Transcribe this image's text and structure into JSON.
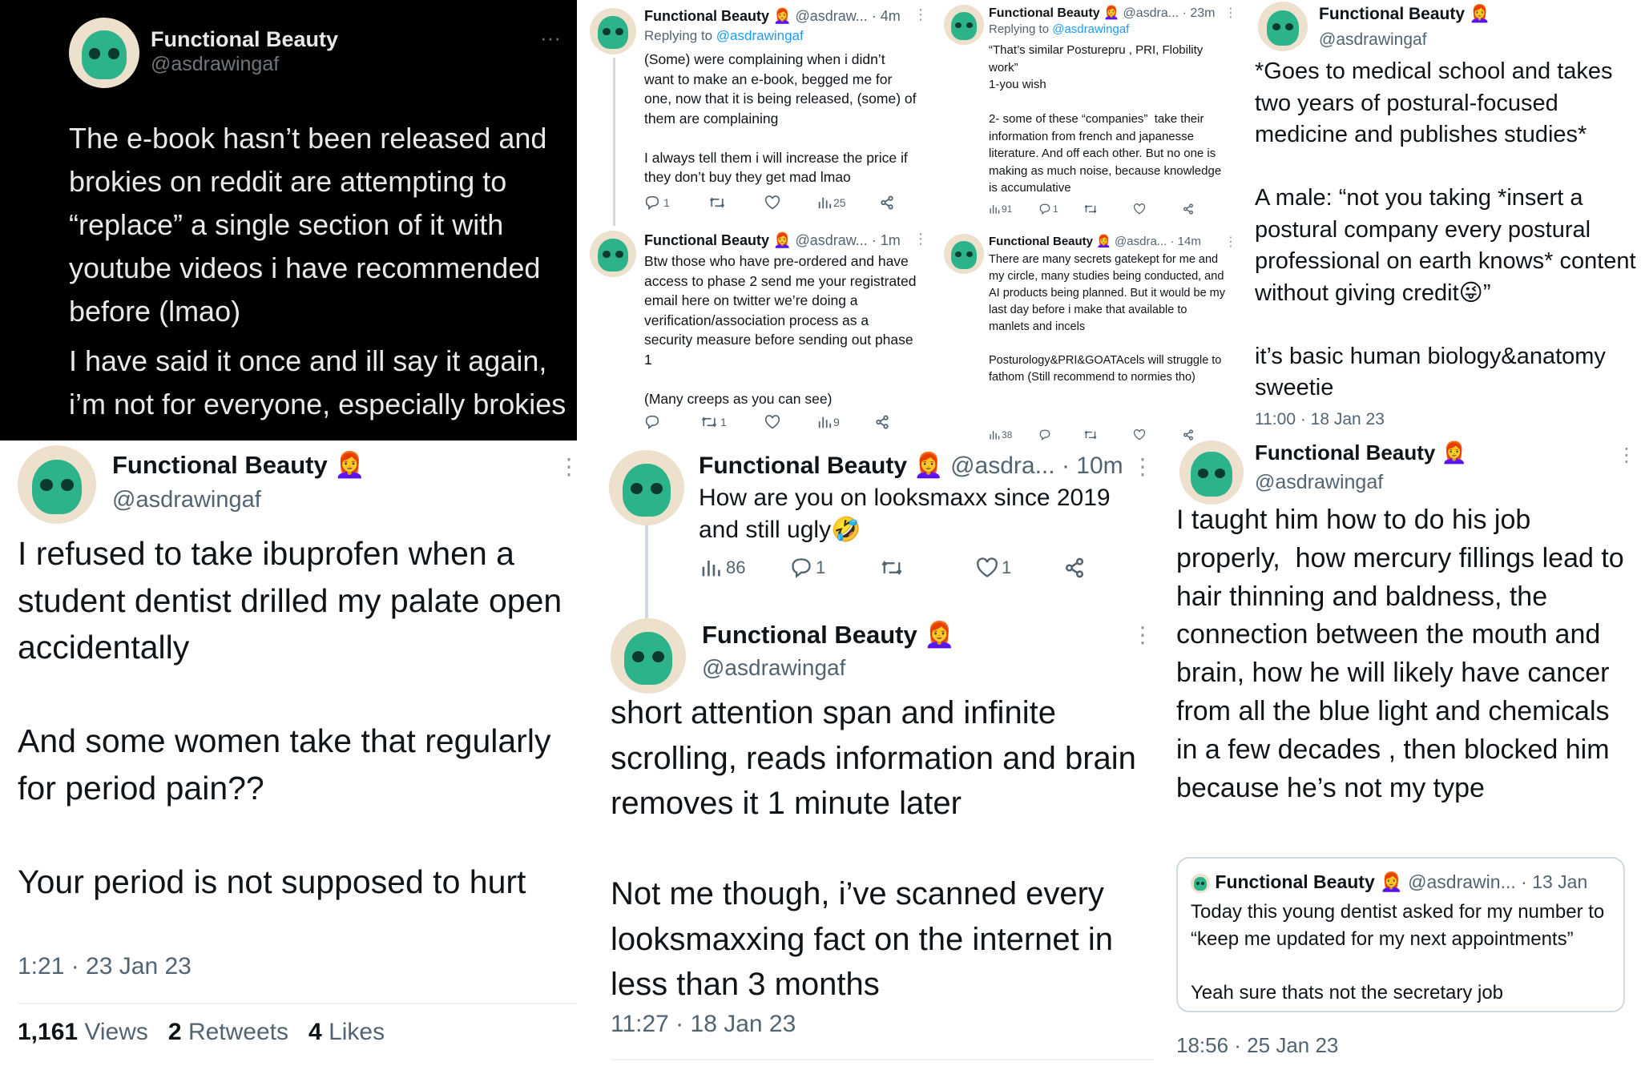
{
  "p1": {
    "name": "Functional Beauty",
    "handle": "@asdrawingaf",
    "text1": "The e-book hasn’t been released and brokies on reddit are attempting to “replace” a single section of it with youtube videos i have recommended before (lmao)",
    "text2": "I have said it once and ill say it again, i’m not for everyone, especially brokies",
    "more": "···"
  },
  "p2": {
    "t1": {
      "name": "Functional Beauty",
      "emoji": "👩‍🦰",
      "handle": "@asdraw...",
      "time": "· 4m",
      "replying_label": "Replying to",
      "replying_to": "@asdrawingaf",
      "text": "(Some) were complaining when i didn’t want to make an e-book, begged me for one, now that it is being released, (some) of them are complaining\n\nI always tell them i will increase the price if they don’t buy they get mad lmao",
      "replies": "1",
      "retweets": "",
      "likes": "",
      "views": "25"
    },
    "t2": {
      "name": "Functional Beauty",
      "emoji": "👩‍🦰",
      "handle": "@asdraw...",
      "time": "· 1m",
      "text": "Btw those who have pre-ordered and have access to phase 2 send me your registrated email here on twitter we’re doing a verification/association process as a security measure before sending out phase 1\n\n(Many creeps as you can see)",
      "replies": "",
      "retweets": "1",
      "likes": "",
      "views": "9"
    }
  },
  "p3": {
    "t1": {
      "name": "Functional Beauty",
      "emoji": "👩‍🦰",
      "handle": "@asdra...",
      "time": "· 23m",
      "replying_label": "Replying to",
      "replying_to": "@asdrawingaf",
      "text": "“That’s similar Posturepru , PRI, Flobility work”\n1-you wish\n\n2- some of these “companies”  take their information from french and japanesse literature. And off each other. But no one is making as much noise, because knowledge is accumulative",
      "views": "91",
      "replies": "1",
      "retweets": "",
      "likes": ""
    },
    "t2": {
      "name": "Functional Beauty",
      "emoji": "👩‍🦰",
      "handle": "@asdra...",
      "time": "· 14m",
      "text": "There are many secrets gatekept for me and my circle, many studies being conducted, and AI products being planned. But it would be my last day before i make that available to manlets and incels\n\nPosturology&PRI&GOATAcels will struggle to fathom (Still recommend to normies tho)",
      "views": "38",
      "replies": "",
      "retweets": "",
      "likes": ""
    }
  },
  "p4": {
    "name": "Functional Beauty",
    "emoji": "👩‍🦰",
    "handle": "@asdrawingaf",
    "text": "*Goes to medical school and takes two years of postural-focused medicine and publishes studies*\n\nA male: “not you taking *insert a postural company every postural professional on earth knows* content without giving credit😜”\n\nit’s basic human biology&anatomy sweetie",
    "timestamp": "11:00 · 18 Jan 23"
  },
  "p5": {
    "name": "Functional Beauty",
    "emoji": "👩‍🦰",
    "handle": "@asdrawingaf",
    "text": "I refused to take ibuprofen when a student dentist drilled my palate open accidentally\n\nAnd some women take that regularly for period pain??\n\nYour period is not supposed to hurt",
    "timestamp": "1:21 · 23 Jan 23",
    "views_count": "1,161",
    "views_label": "Views",
    "retweets_count": "2",
    "retweets_label": "Retweets",
    "likes_count": "4",
    "likes_label": "Likes"
  },
  "p6": {
    "t1": {
      "name": "Functional Beauty",
      "emoji": "👩‍🦰",
      "handle": "@asdra...",
      "time": "· 10m",
      "text": "How are you on looksmaxx since 2019 and still ugly🤣",
      "views": "86",
      "replies": "1",
      "retweets": "",
      "likes": "1"
    },
    "t2": {
      "name": "Functional Beauty",
      "emoji": "👩‍🦰",
      "handle": "@asdrawingaf",
      "text": "short attention span and infinite scrolling, reads information and brain removes it 1 minute later\n\nNot me though, i’ve scanned every looksmaxxing fact on the internet in less than 3 months",
      "timestamp": "11:27 · 18 Jan 23"
    }
  },
  "p7": {
    "name": "Functional Beauty",
    "emoji": "👩‍🦰",
    "handle": "@asdrawingaf",
    "text": "I taught him how to do his job properly,  how mercury fillings lead to hair thinning and baldness, the connection between the mouth and brain, how he will likely have cancer from all the blue light and chemicals in a few decades , then blocked him because he’s not my type",
    "quote": {
      "name": "Functional Beauty",
      "emoji": "👩‍🦰",
      "handle": "@asdrawin...",
      "time": "· 13 Jan",
      "text": "Today this young dentist asked for my number to “keep me updated for my next appointments”\n\nYeah sure thats not the secretary job"
    },
    "timestamp": "18:56 · 25 Jan 23"
  },
  "icons": {
    "reply": "reply-icon",
    "retweet": "retweet-icon",
    "like": "like-icon",
    "views": "views-icon",
    "share": "share-icon",
    "more": "more-icon"
  },
  "colors": {
    "link": "#1d9bf0",
    "avatar_skull": "#2db38a",
    "dark_bg": "#000000"
  }
}
